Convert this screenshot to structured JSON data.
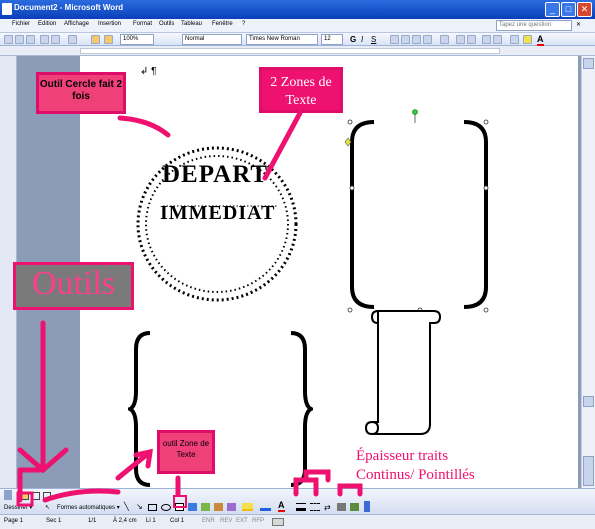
{
  "window": {
    "title": "Document2 - Microsoft Word",
    "help_placeholder": "Tapez une question"
  },
  "menu": [
    "Fichier",
    "Edition",
    "Affichage",
    "Insertion",
    "Format",
    "Outils",
    "Tableau",
    "Fenêtre",
    "?"
  ],
  "toolbar": {
    "zoom": "100%",
    "style": "Normal",
    "font": "Times New Roman",
    "size": "12"
  },
  "badge": {
    "text": "DEPART",
    "sub": "IMMEDIAT"
  },
  "annotations": {
    "cercle": "Outil Cercle fait 2 fois",
    "zones": "2 Zones de Texte",
    "outils": "Outils",
    "zone_outil": "outil Zone de Texte",
    "epaisseur": "Épaisseur traits Continus/ Pointillés"
  },
  "drawbar": {
    "dessiner": "Dessiner ▾",
    "formes": "Formes automatiques ▾"
  },
  "status": {
    "page": "Page 1",
    "section": "Sec 1",
    "pages": "1/1",
    "pos": "À 2,4 cm",
    "line": "Li 1",
    "col": "Col 1",
    "modes": [
      "ENR",
      "REV",
      "EXT",
      "RFP"
    ]
  },
  "colors": {
    "accent": "#ee1170",
    "title_blue": "#0a3fb8"
  }
}
